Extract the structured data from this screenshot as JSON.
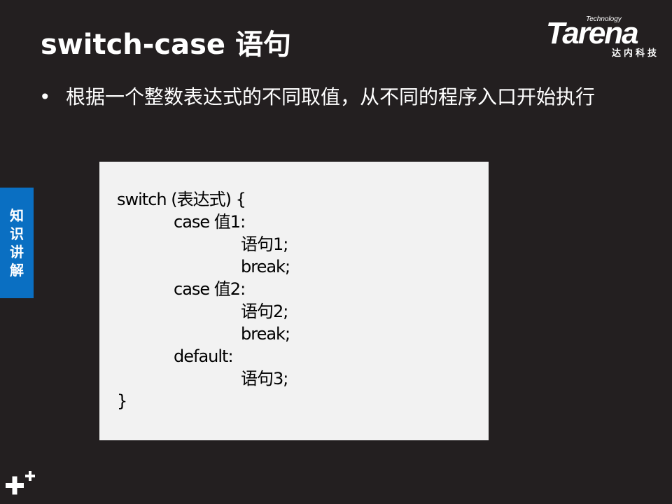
{
  "slide": {
    "title": "switch-case 语句",
    "bullet": "根据一个整数表达式的不同取值，从不同的程序入口开始执行",
    "side_tab": [
      "知",
      "识",
      "讲",
      "解"
    ],
    "code_lines": [
      "switch (表达式) {",
      "case 值1:",
      "语句1;",
      "break;",
      "case 值2:",
      "语句2;",
      "break;",
      "default:",
      "语句3;",
      "}"
    ]
  },
  "logo": {
    "technology": "Technology",
    "name": "Tarena",
    "subtitle": "达内科技"
  },
  "colors": {
    "background": "#231f20",
    "tab_blue": "#0a6fc2",
    "code_bg": "#f2f2f2"
  }
}
